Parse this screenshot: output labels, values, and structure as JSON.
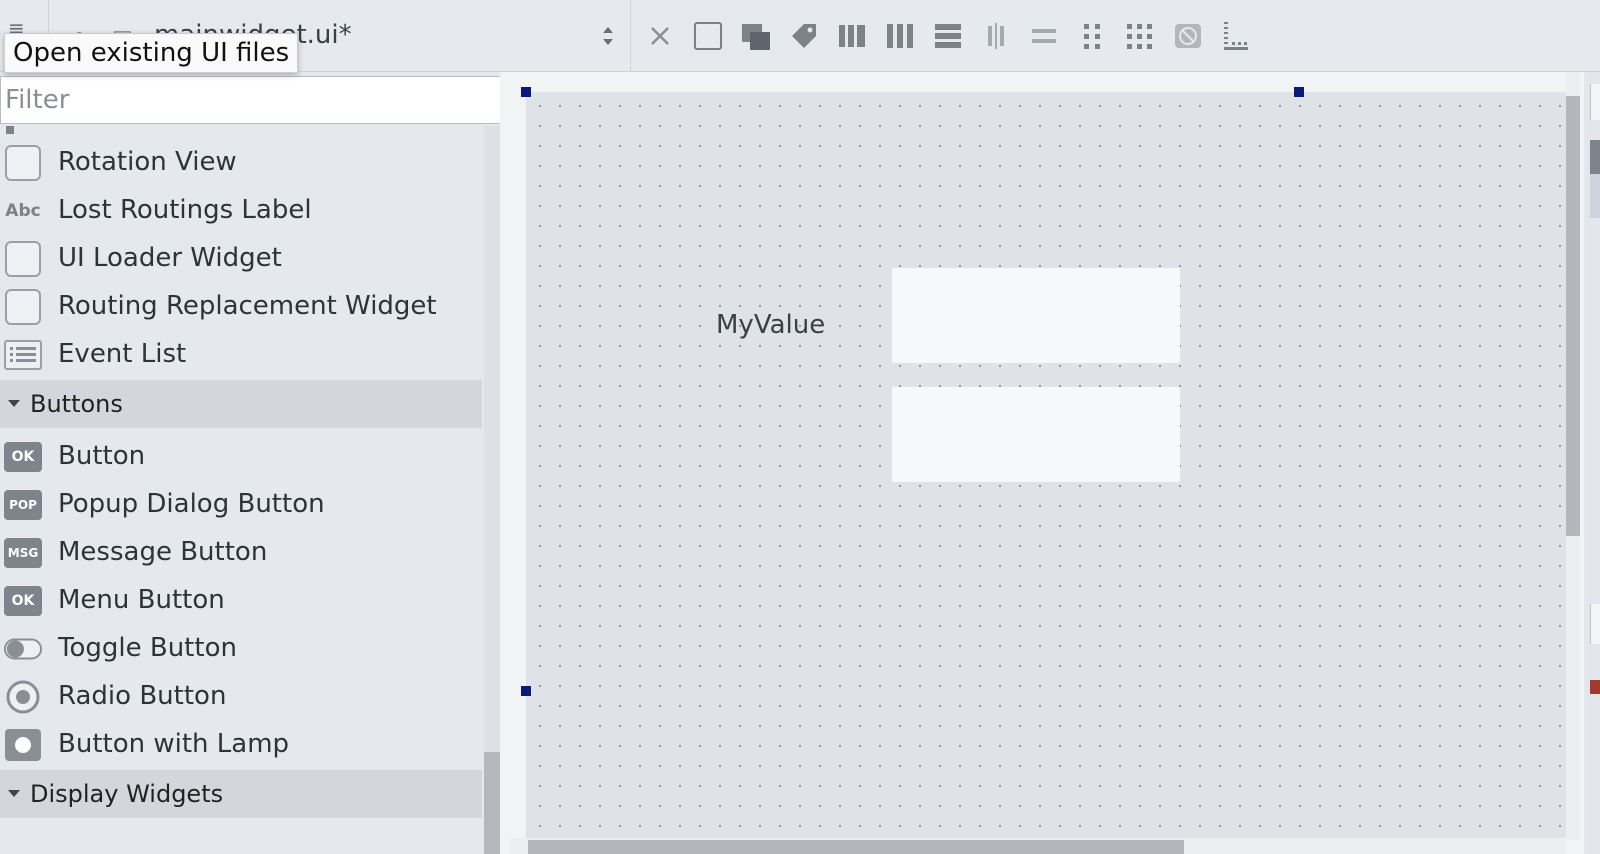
{
  "toolbar": {
    "file_name": "mainwidget.ui*",
    "tooltip": "Open existing UI files",
    "icons": [
      "close-icon",
      "frame-icon",
      "group-icon",
      "tag-icon",
      "layout-horizontal-split-icon",
      "layout-horizontal-icon",
      "layout-vertical-icon",
      "layout-horizontal-splitter-icon",
      "layout-vertical-splitter-icon",
      "grid-icon",
      "form-grid-icon",
      "break-layout-icon",
      "adjust-size-icon"
    ]
  },
  "sidebar": {
    "filter_placeholder": "Filter",
    "items_top": [
      {
        "label": "Rotation View",
        "icon": "widget-icon"
      },
      {
        "label": "Lost Routings Label",
        "icon": "abc-label-icon"
      },
      {
        "label": "UI Loader Widget",
        "icon": "widget-icon"
      },
      {
        "label": "Routing Replacement Widget",
        "icon": "widget-icon"
      },
      {
        "label": "Event List",
        "icon": "list-icon"
      }
    ],
    "category_buttons": "Buttons",
    "buttons": [
      {
        "label": "Button",
        "badge": "OK"
      },
      {
        "label": "Popup Dialog Button",
        "badge": "POP"
      },
      {
        "label": "Message Button",
        "badge": "MSG"
      },
      {
        "label": "Menu Button",
        "badge": "OK"
      },
      {
        "label": "Toggle Button",
        "icon": "toggle-icon"
      },
      {
        "label": "Radio Button",
        "icon": "radio-icon"
      },
      {
        "label": "Button with Lamp",
        "icon": "lamp-icon"
      }
    ],
    "category_display": "Display Widgets"
  },
  "form": {
    "label_text": "MyValue"
  },
  "colors": {
    "selection_handle": "#0b1a7a",
    "form_bg": "#dfe2e6"
  }
}
